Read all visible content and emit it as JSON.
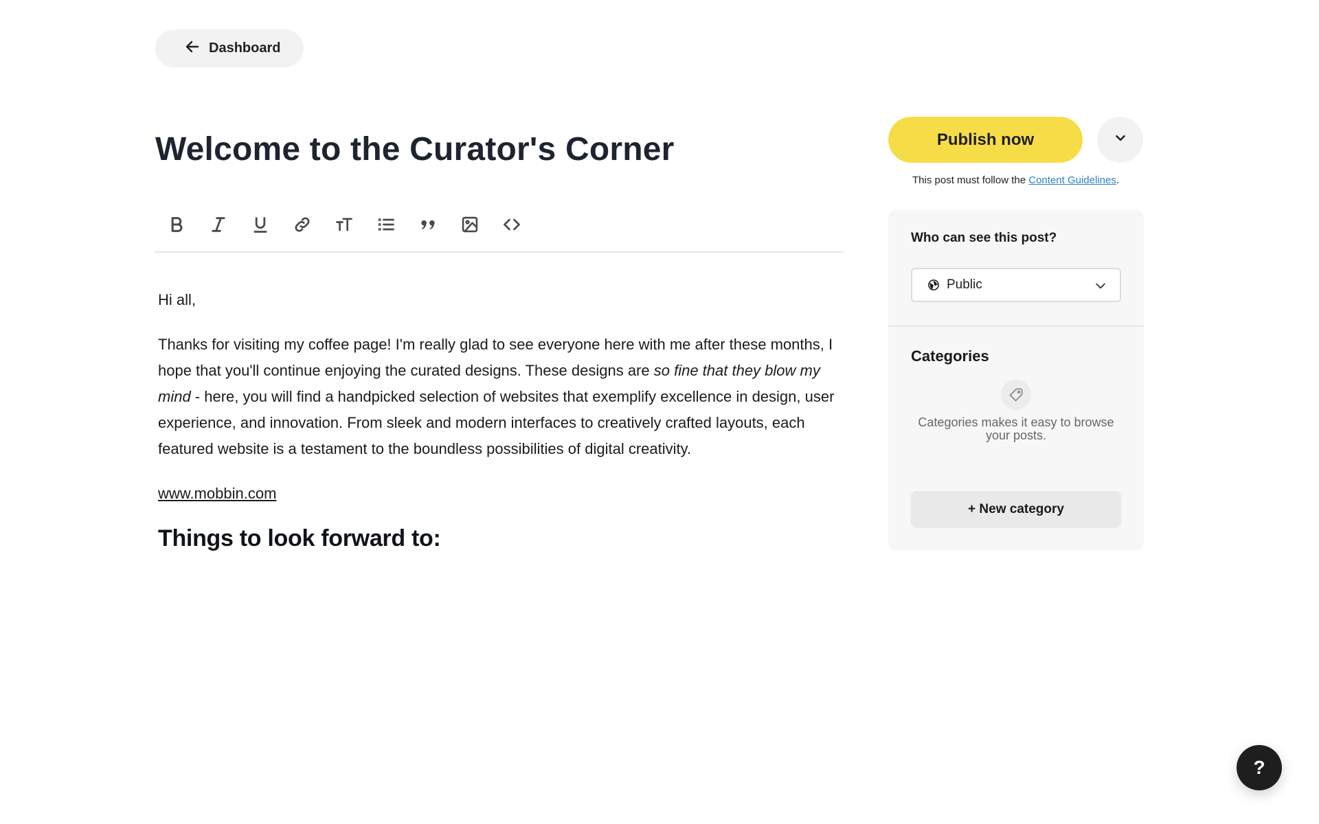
{
  "nav": {
    "back_label": "Dashboard",
    "back_icon": "arrow-left-icon"
  },
  "post": {
    "title": "Welcome to the Curator's Corner"
  },
  "toolbar": {
    "tools": [
      {
        "name": "bold-icon"
      },
      {
        "name": "italic-icon"
      },
      {
        "name": "underline-icon"
      },
      {
        "name": "link-icon"
      },
      {
        "name": "text-size-icon"
      },
      {
        "name": "list-icon"
      },
      {
        "name": "quote-icon"
      },
      {
        "name": "image-icon"
      },
      {
        "name": "code-icon"
      }
    ]
  },
  "content": {
    "greeting": "Hi all,",
    "para_part1": "Thanks for visiting my coffee page! I'm really glad to see everyone here with me after these months, I hope that you'll continue enjoying the curated designs. These designs are ",
    "para_emphasis": "so fine that they blow my mind",
    "para_part2": " - here, you will find a handpicked selection of websites that exemplify excellence in design, user experience, and innovation. From sleek and modern interfaces to creatively crafted layouts, each featured website is a testament to the boundless possibilities of digital creativity.",
    "link": "www.mobbin.com",
    "subheading": "Things to look forward to:"
  },
  "publish": {
    "button_label": "Publish now",
    "guidelines_prefix": "This post must follow the ",
    "guidelines_link": "Content Guidelines",
    "guidelines_suffix": "."
  },
  "visibility": {
    "label": "Who can see this post?",
    "selected": "Public"
  },
  "categories": {
    "heading": "Categories",
    "empty_text": "Categories makes it easy to browse your posts.",
    "new_button": "+ New category"
  },
  "help": {
    "label": "?"
  },
  "colors": {
    "accent": "#f6dd48",
    "link": "#2f7fc1",
    "panel": "#f7f7f7"
  }
}
